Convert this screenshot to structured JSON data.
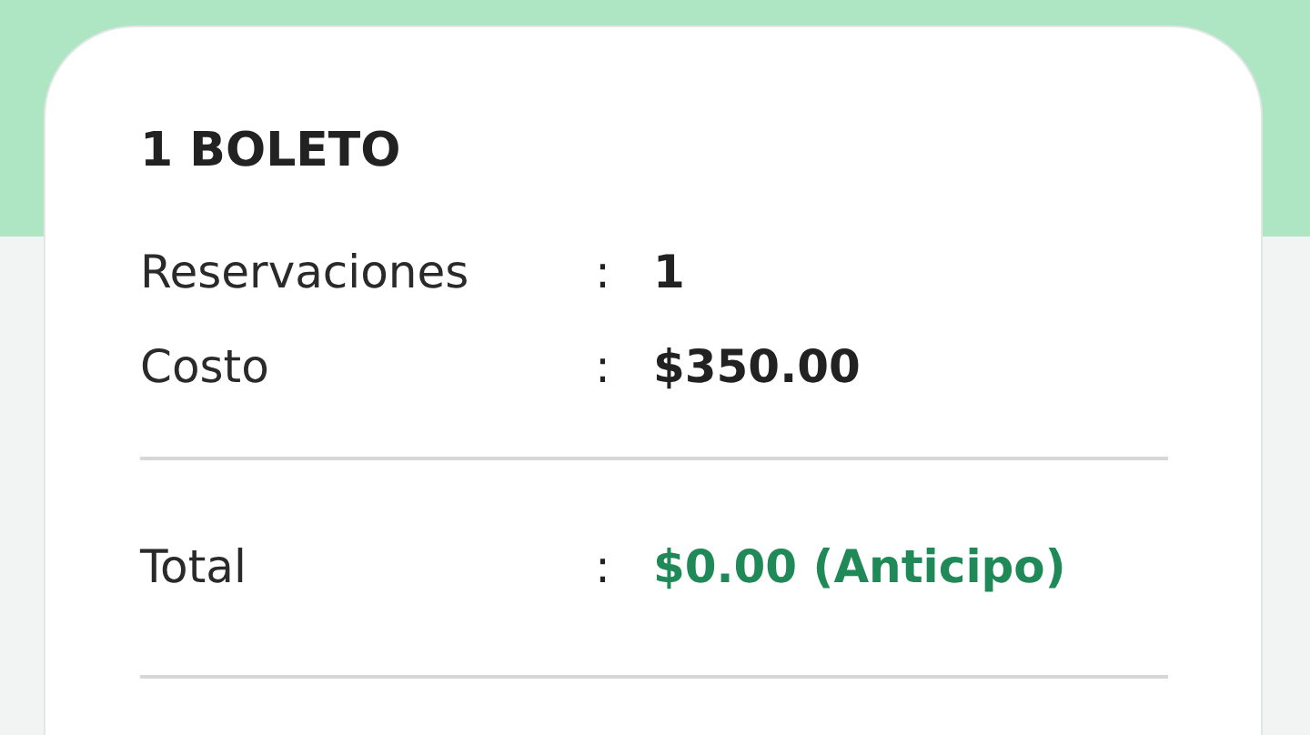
{
  "card": {
    "title": "1 BOLETO",
    "rows": [
      {
        "label": "Reservaciones",
        "separator": ":",
        "value": "1"
      },
      {
        "label": "Costo",
        "separator": ":",
        "value": "$350.00"
      }
    ],
    "total": {
      "label": "Total",
      "separator": ":",
      "value": "$0.00 (Anticipo)"
    }
  }
}
